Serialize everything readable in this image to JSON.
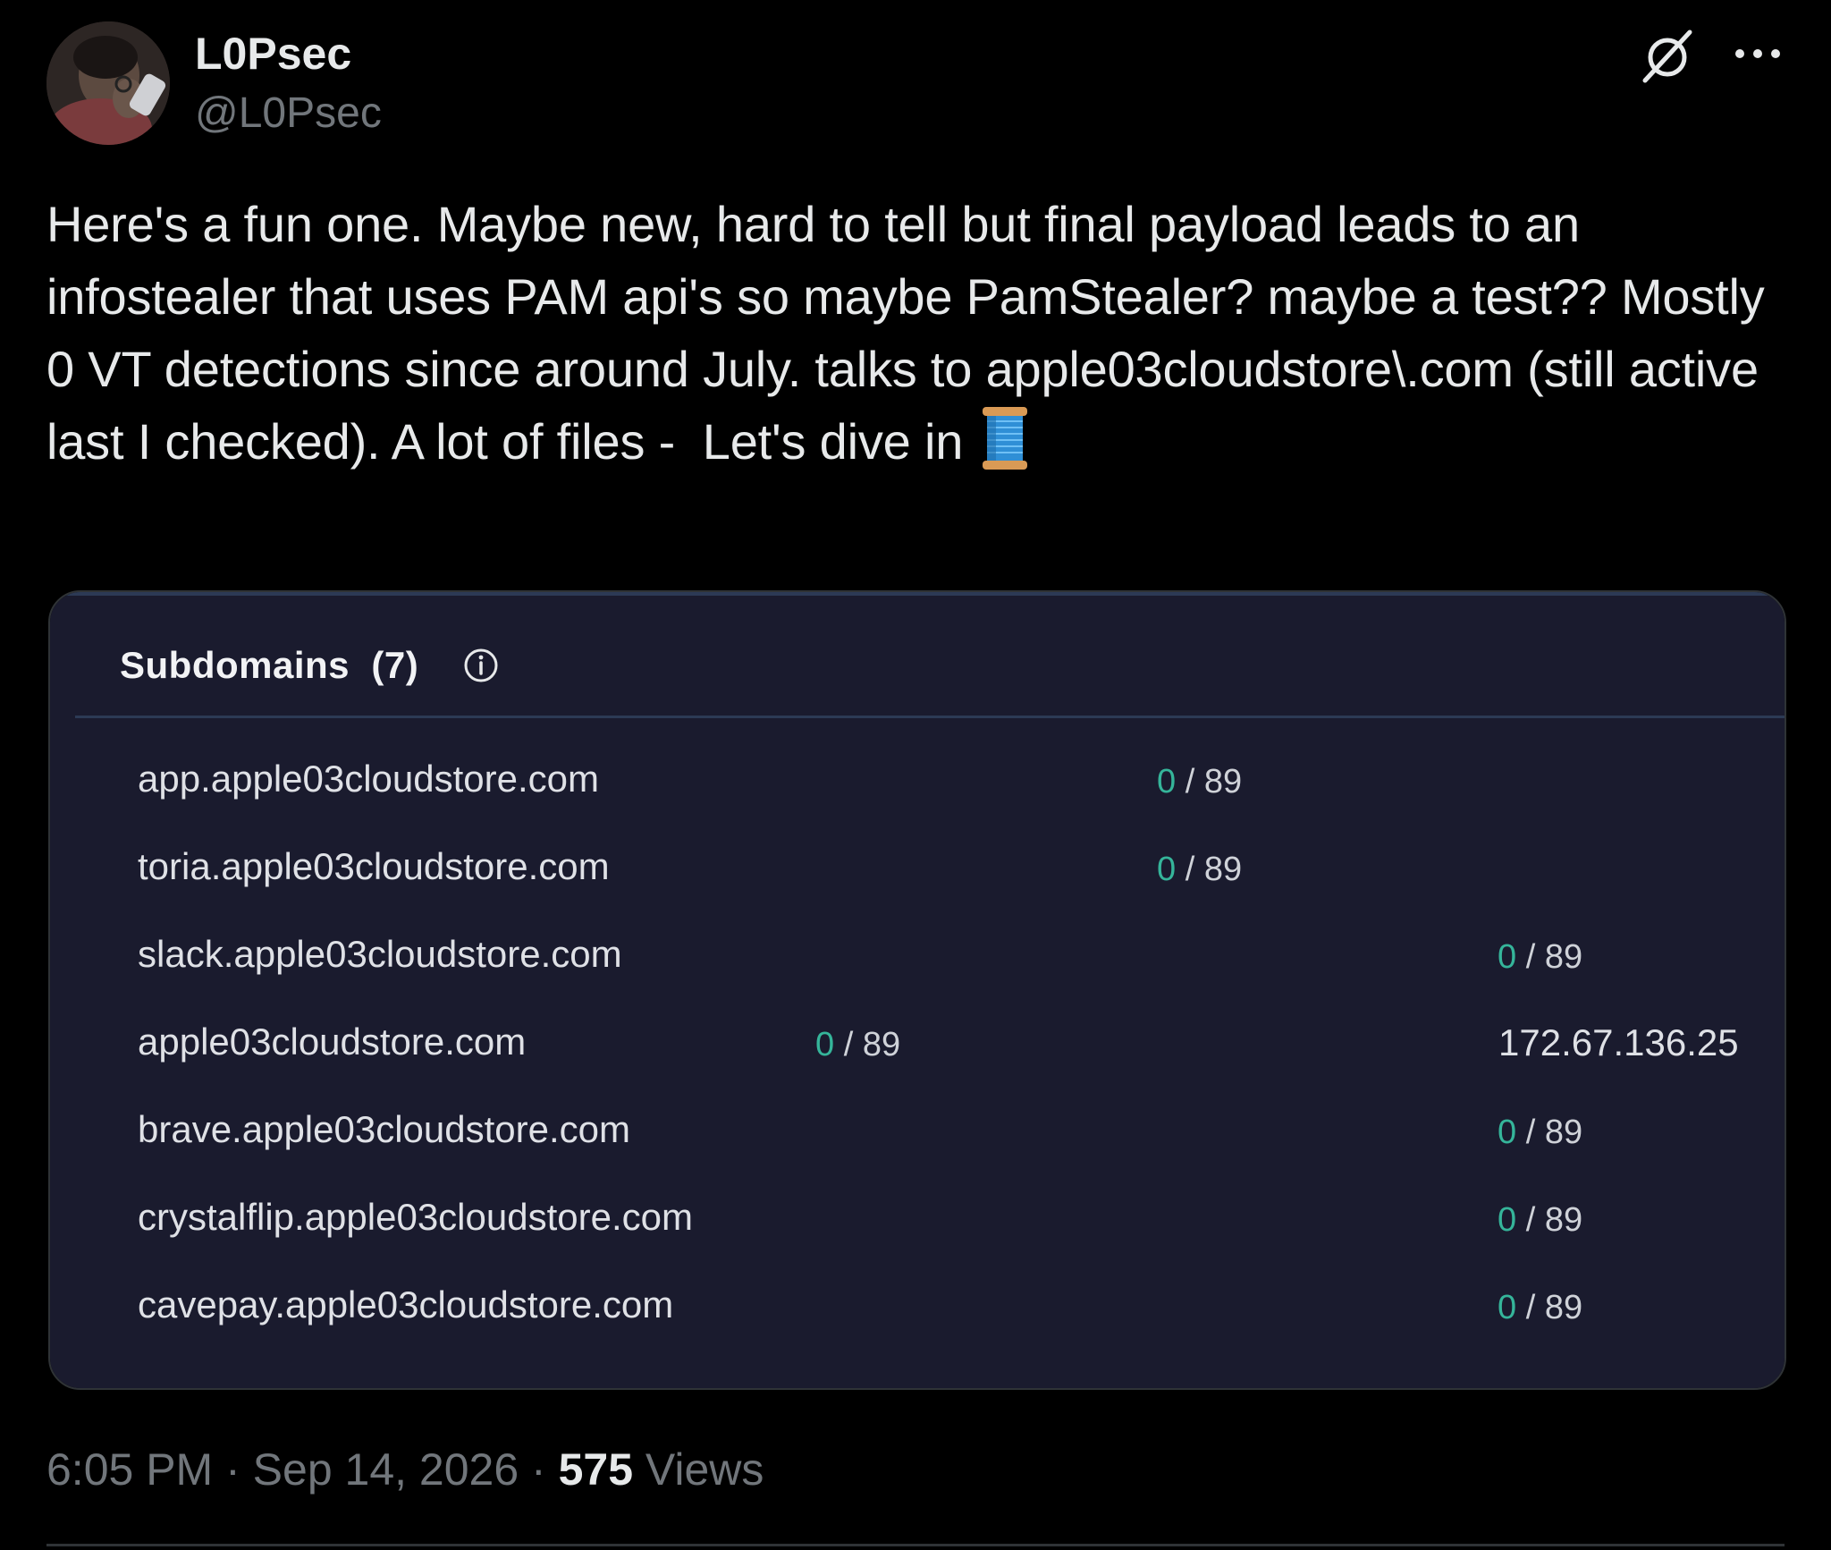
{
  "author": {
    "display_name": "L0Psec",
    "handle": "@L0Psec"
  },
  "tweet": {
    "text": "Here's a fun one. Maybe new, hard to tell but final payload leads to an infostealer that uses PAM api's so maybe PamStealer? maybe a test?? Mostly 0 VT detections since around July. talks to apple03cloudstore\\.com (still active last I checked). A lot of files -  Let's dive in"
  },
  "icons": {
    "avatar": "avatar-photo",
    "grok": "grok-icon",
    "more": "more-icon",
    "emoji": "spool-of-thread-emoji",
    "info": "info-icon"
  },
  "card": {
    "title": "Subdomains",
    "count": "(7)",
    "rows": [
      {
        "domain": "app.apple03cloudstore.com",
        "score_zero": "0",
        "score_rest": " / 89",
        "ip": ""
      },
      {
        "domain": "toria.apple03cloudstore.com",
        "score_zero": "0",
        "score_rest": " / 89",
        "ip": ""
      },
      {
        "domain": "slack.apple03cloudstore.com",
        "score_zero": "0",
        "score_rest": " / 89",
        "ip": ""
      },
      {
        "domain": "apple03cloudstore.com",
        "score_zero": "0",
        "score_rest": " / 89",
        "ip": "172.67.136.25"
      },
      {
        "domain": "brave.apple03cloudstore.com",
        "score_zero": "0",
        "score_rest": " / 89",
        "ip": ""
      },
      {
        "domain": "crystalflip.apple03cloudstore.com",
        "score_zero": "0",
        "score_rest": " / 89",
        "ip": ""
      },
      {
        "domain": "cavepay.apple03cloudstore.com",
        "score_zero": "0",
        "score_rest": " / 89",
        "ip": ""
      }
    ]
  },
  "meta": {
    "time": "6:05 PM",
    "separator": " · ",
    "date": "Sep 14, 2026",
    "views_count": "575",
    "views_label": " Views"
  },
  "colors": {
    "background": "#000000",
    "card_bg": "#1a1b2e",
    "zero_score": "#35b59a",
    "secondary_text": "#71767b"
  }
}
